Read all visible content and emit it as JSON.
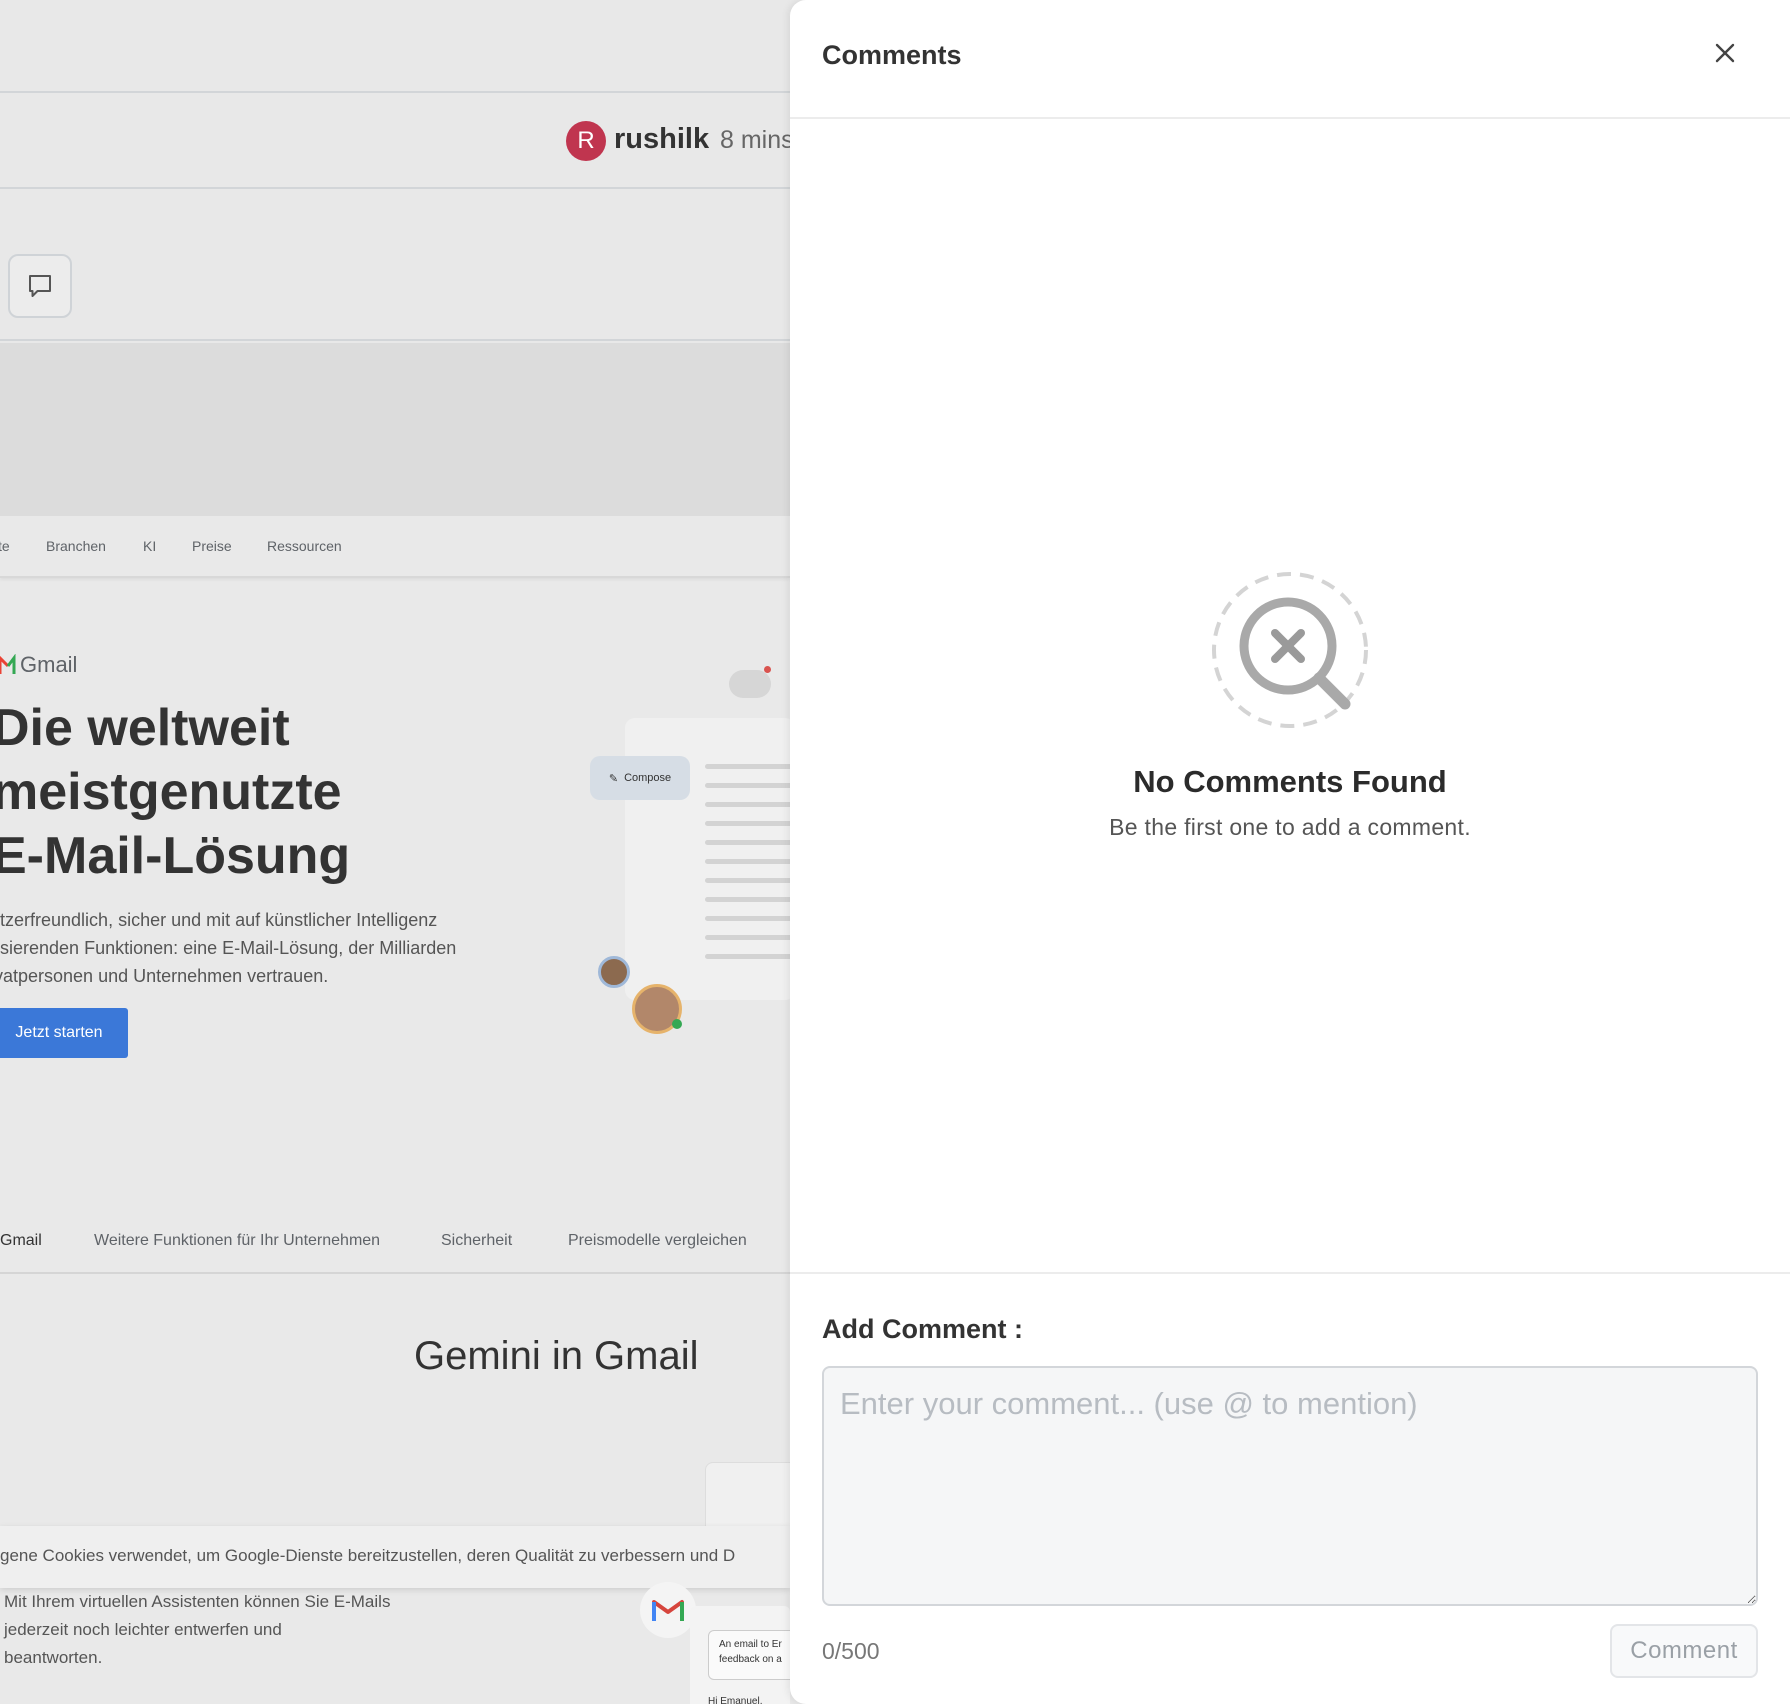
{
  "background": {
    "user": {
      "avatar_initial": "R",
      "name": "rushilk",
      "time": "8 mins"
    },
    "nav": [
      "te",
      "Branchen",
      "KI",
      "Preise",
      "Ressourcen"
    ],
    "gmail_word": "Gmail",
    "heading": "Die weltweit\nmeistgenutzte\nE-Mail-Lösung",
    "subtext": "utzerfreundlich, sicher und mit auf künstlicher Intelligenz\nasierenden Funktionen: eine E-Mail-Lösung, der Milliarden\nivatpersonen und Unternehmen vertrauen.",
    "cta": "Jetzt starten",
    "compose": "Compose",
    "tabs": [
      "Gmail",
      "Weitere Funktionen für Ihr Unternehmen",
      "Sicherheit",
      "Preismodelle vergleichen"
    ],
    "section_title": "Gemini in Gmail",
    "cookie_text": "gene Cookies verwendet, um Google-Dienste bereitzustellen, deren Qualität zu verbessern und D",
    "bottom_text": "Mit Ihrem virtuellen Assistenten können Sie E-Mails\njederzeit noch leichter entwerfen und\nbeantworten.",
    "email_card": "An email to Er\nfeedback on a",
    "email_greeting": "Hi Emanuel,"
  },
  "drawer": {
    "title": "Comments",
    "empty_title": "No Comments Found",
    "empty_subtitle": "Be the first one to add a comment.",
    "add_label": "Add Comment :",
    "input_placeholder": "Enter your comment... (use @ to mention)",
    "input_value": "",
    "char_count": "0/500",
    "submit_label": "Comment"
  },
  "icons": {
    "close": "close-icon",
    "empty": "search-not-found-icon",
    "comment": "comment-bubble-icon"
  },
  "colors": {
    "avatar": "#c0354f",
    "cta": "#3b78d8",
    "drawer_bg": "#ffffff",
    "overlay_bg": "#e8e8e8"
  }
}
